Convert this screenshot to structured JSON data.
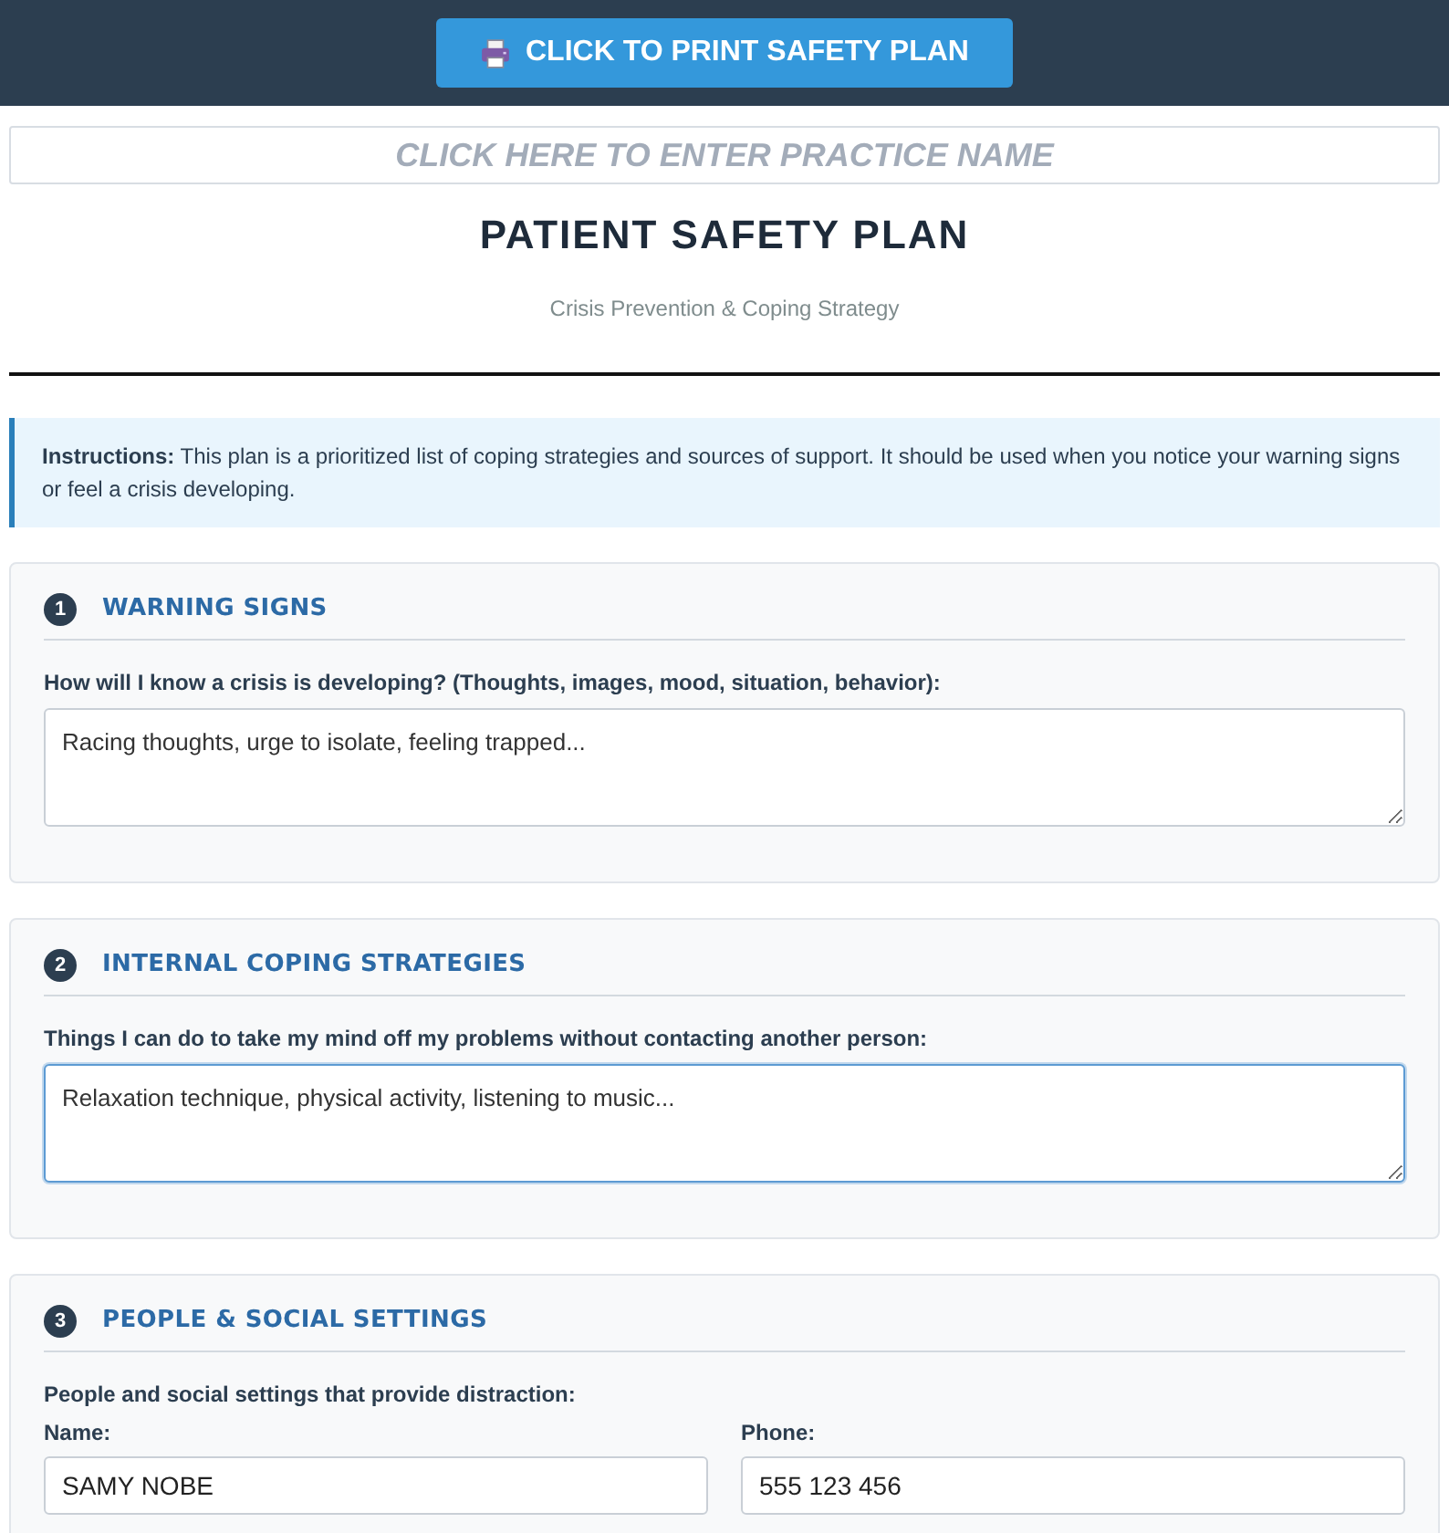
{
  "print_button": {
    "label": "CLICK TO PRINT SAFETY PLAN"
  },
  "practice_name": {
    "placeholder": "CLICK HERE TO ENTER PRACTICE NAME"
  },
  "header": {
    "title": "PATIENT SAFETY PLAN",
    "subtitle": "Crisis Prevention & Coping Strategy"
  },
  "instructions": {
    "text": "**Instructions:** This plan is a prioritized list of coping strategies and sources of support. It should be used when you notice your warning signs or feel a crisis developing."
  },
  "sections": [
    {
      "number": "1",
      "title": "WARNING SIGNS",
      "prompt": "How will I know a crisis is developing? (Thoughts, images, mood, situation, behavior):",
      "fields": [
        {
          "kind": "textarea",
          "value": "Racing thoughts, urge to isolate, feeling trapped...",
          "focused": false
        }
      ]
    },
    {
      "number": "2",
      "title": "INTERNAL COPING STRATEGIES",
      "prompt": "Things I can do to take my mind off my problems without contacting another person:",
      "fields": [
        {
          "kind": "textarea",
          "value": "Relaxation technique, physical activity, listening to music...",
          "focused": true
        }
      ]
    },
    {
      "number": "3",
      "title": "PEOPLE & SOCIAL SETTINGS",
      "prompt": "People and social settings that provide distraction:",
      "fields": [
        {
          "kind": "input",
          "label": "Name:",
          "value": "SAMY NOBE",
          "focused": false
        },
        {
          "kind": "input",
          "label": "Phone:",
          "value": "555 123 456",
          "focused": false
        }
      ]
    }
  ]
}
